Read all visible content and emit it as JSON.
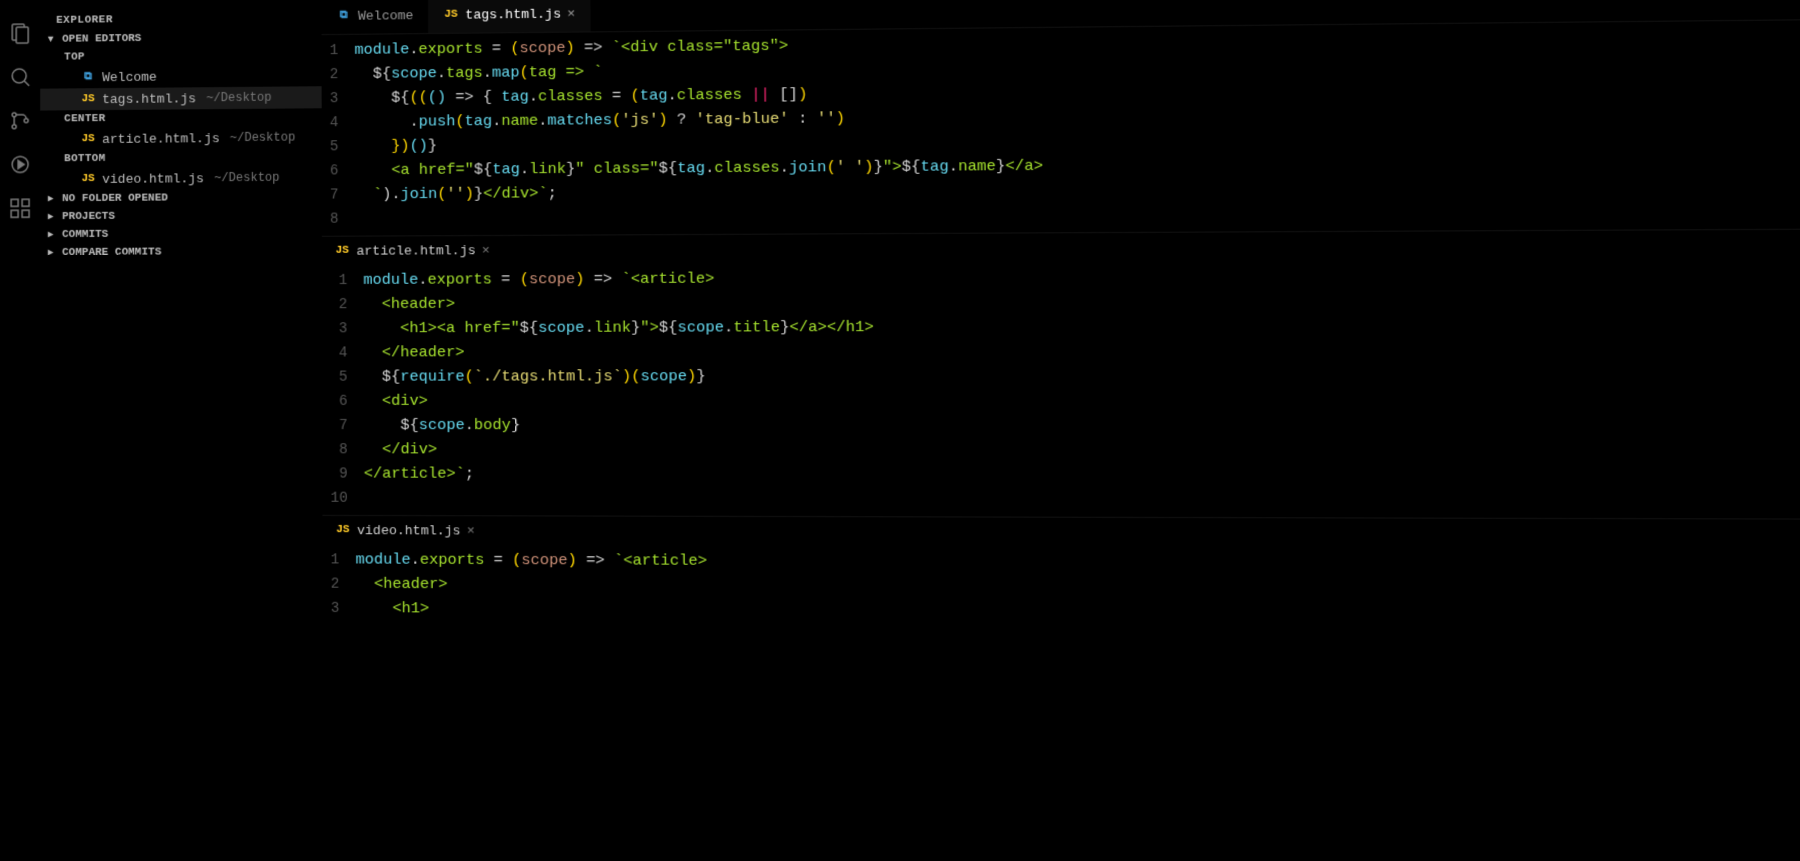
{
  "sidebar": {
    "title": "EXPLORER",
    "open_editors_label": "OPEN EDITORS",
    "groups": {
      "top": {
        "label": "TOP",
        "items": [
          {
            "icon": "vscode",
            "name": "Welcome",
            "path": ""
          },
          {
            "icon": "js",
            "name": "tags.html.js",
            "path": "~/Desktop"
          }
        ]
      },
      "center": {
        "label": "CENTER",
        "items": [
          {
            "icon": "js",
            "name": "article.html.js",
            "path": "~/Desktop"
          }
        ]
      },
      "bottom": {
        "label": "BOTTOM",
        "items": [
          {
            "icon": "js",
            "name": "video.html.js",
            "path": "~/Desktop"
          }
        ]
      }
    },
    "sections": [
      "NO FOLDER OPENED",
      "PROJECTS",
      "COMMITS",
      "COMPARE COMMITS"
    ]
  },
  "tabs": {
    "top": [
      {
        "icon": "vscode",
        "label": "Welcome",
        "active": false,
        "closable": false
      },
      {
        "icon": "js",
        "label": "tags.html.js",
        "active": true,
        "closable": true
      }
    ]
  },
  "panes": {
    "top": {
      "file": "tags.html.js",
      "lines": [
        "1",
        "2",
        "3",
        "4",
        "5",
        "6",
        "7",
        "8"
      ],
      "tokens": [
        [
          [
            "module",
            "t-skyblue"
          ],
          [
            ".",
            "t-white"
          ],
          [
            "exports",
            "t-lime"
          ],
          [
            " = ",
            "t-white"
          ],
          [
            "(",
            "t-gold"
          ],
          [
            "scope",
            "t-orange"
          ],
          [
            ")",
            "t-gold"
          ],
          [
            " => ",
            "t-white"
          ],
          [
            "`<div class=\"tags\">",
            "t-lime"
          ]
        ],
        [
          [
            "  ${",
            "t-white"
          ],
          [
            "scope",
            "t-skyblue"
          ],
          [
            ".",
            "t-white"
          ],
          [
            "tags",
            "t-lime"
          ],
          [
            ".",
            "t-white"
          ],
          [
            "map",
            "t-skyblue"
          ],
          [
            "(",
            "t-gold"
          ],
          [
            "tag => `",
            "t-lime"
          ]
        ],
        [
          [
            "    ${",
            "t-white"
          ],
          [
            "((",
            "t-gold"
          ],
          [
            "()",
            "t-skyblue"
          ],
          [
            " => { ",
            "t-white"
          ],
          [
            "tag",
            "t-skyblue"
          ],
          [
            ".",
            "t-white"
          ],
          [
            "classes",
            "t-lime"
          ],
          [
            " = ",
            "t-white"
          ],
          [
            "(",
            "t-gold"
          ],
          [
            "tag",
            "t-skyblue"
          ],
          [
            ".",
            "t-white"
          ],
          [
            "classes",
            "t-lime"
          ],
          [
            " || ",
            "t-pink"
          ],
          [
            "[]",
            "t-white"
          ],
          [
            ")",
            "t-gold"
          ]
        ],
        [
          [
            "      .",
            "t-white"
          ],
          [
            "push",
            "t-skyblue"
          ],
          [
            "(",
            "t-gold"
          ],
          [
            "tag",
            "t-skyblue"
          ],
          [
            ".",
            "t-white"
          ],
          [
            "name",
            "t-lime"
          ],
          [
            ".",
            "t-white"
          ],
          [
            "matches",
            "t-skyblue"
          ],
          [
            "(",
            "t-gold"
          ],
          [
            "'js'",
            "t-string"
          ],
          [
            ")",
            "t-gold"
          ],
          [
            " ? ",
            "t-white"
          ],
          [
            "'tag-blue'",
            "t-string"
          ],
          [
            " : ",
            "t-white"
          ],
          [
            "''",
            "t-string"
          ],
          [
            ")",
            "t-gold"
          ]
        ],
        [
          [
            "    })",
            "t-gold"
          ],
          [
            "()",
            "t-skyblue"
          ],
          [
            "}",
            "t-white"
          ]
        ],
        [
          [
            "    <a href=\"",
            "t-lime"
          ],
          [
            "${",
            "t-white"
          ],
          [
            "tag",
            "t-skyblue"
          ],
          [
            ".",
            "t-white"
          ],
          [
            "link",
            "t-lime"
          ],
          [
            "}",
            "t-white"
          ],
          [
            "\" class=\"",
            "t-lime"
          ],
          [
            "${",
            "t-white"
          ],
          [
            "tag",
            "t-skyblue"
          ],
          [
            ".",
            "t-white"
          ],
          [
            "classes",
            "t-lime"
          ],
          [
            ".",
            "t-white"
          ],
          [
            "join",
            "t-skyblue"
          ],
          [
            "(",
            "t-gold"
          ],
          [
            "' '",
            "t-string"
          ],
          [
            ")",
            "t-gold"
          ],
          [
            "}",
            "t-white"
          ],
          [
            "\">",
            "t-lime"
          ],
          [
            "${",
            "t-white"
          ],
          [
            "tag",
            "t-skyblue"
          ],
          [
            ".",
            "t-white"
          ],
          [
            "name",
            "t-lime"
          ],
          [
            "}",
            "t-white"
          ],
          [
            "</a>",
            "t-lime"
          ]
        ],
        [
          [
            "  `",
            "t-lime"
          ],
          [
            ").",
            "t-white"
          ],
          [
            "join",
            "t-skyblue"
          ],
          [
            "(",
            "t-gold"
          ],
          [
            "''",
            "t-string"
          ],
          [
            ")",
            "t-gold"
          ],
          [
            "}",
            "t-white"
          ],
          [
            "</div>`",
            "t-lime"
          ],
          [
            ";",
            "t-white"
          ]
        ],
        [
          [
            "",
            "t-white"
          ]
        ]
      ]
    },
    "center": {
      "file": "article.html.js",
      "lines": [
        "1",
        "2",
        "3",
        "4",
        "5",
        "6",
        "7",
        "8",
        "9",
        "10"
      ],
      "tokens": [
        [
          [
            "module",
            "t-skyblue"
          ],
          [
            ".",
            "t-white"
          ],
          [
            "exports",
            "t-lime"
          ],
          [
            " = ",
            "t-white"
          ],
          [
            "(",
            "t-gold"
          ],
          [
            "scope",
            "t-orange"
          ],
          [
            ")",
            "t-gold"
          ],
          [
            " => ",
            "t-white"
          ],
          [
            "`<article>",
            "t-lime"
          ]
        ],
        [
          [
            "  <header>",
            "t-lime"
          ]
        ],
        [
          [
            "    <h1><a href=\"",
            "t-lime"
          ],
          [
            "${",
            "t-white"
          ],
          [
            "scope",
            "t-skyblue"
          ],
          [
            ".",
            "t-white"
          ],
          [
            "link",
            "t-lime"
          ],
          [
            "}",
            "t-white"
          ],
          [
            "\">",
            "t-lime"
          ],
          [
            "${",
            "t-white"
          ],
          [
            "scope",
            "t-skyblue"
          ],
          [
            ".",
            "t-white"
          ],
          [
            "title",
            "t-lime"
          ],
          [
            "}",
            "t-white"
          ],
          [
            "</a></h1>",
            "t-lime"
          ]
        ],
        [
          [
            "  </header>",
            "t-lime"
          ]
        ],
        [
          [
            "  ${",
            "t-white"
          ],
          [
            "require",
            "t-skyblue"
          ],
          [
            "(",
            "t-gold"
          ],
          [
            "`./tags.html.js`",
            "t-string"
          ],
          [
            ")",
            "t-gold"
          ],
          [
            "(",
            "t-gold"
          ],
          [
            "scope",
            "t-skyblue"
          ],
          [
            ")",
            "t-gold"
          ],
          [
            "}",
            "t-white"
          ]
        ],
        [
          [
            "  <div>",
            "t-lime"
          ]
        ],
        [
          [
            "    ${",
            "t-white"
          ],
          [
            "scope",
            "t-skyblue"
          ],
          [
            ".",
            "t-white"
          ],
          [
            "body",
            "t-lime"
          ],
          [
            "}",
            "t-white"
          ]
        ],
        [
          [
            "  </div>",
            "t-lime"
          ]
        ],
        [
          [
            "</article>`",
            "t-lime"
          ],
          [
            ";",
            "t-white"
          ]
        ],
        [
          [
            "",
            "t-white"
          ]
        ]
      ]
    },
    "bottom": {
      "file": "video.html.js",
      "lines": [
        "1",
        "2",
        "3"
      ],
      "tokens": [
        [
          [
            "module",
            "t-skyblue"
          ],
          [
            ".",
            "t-white"
          ],
          [
            "exports",
            "t-lime"
          ],
          [
            " = ",
            "t-white"
          ],
          [
            "(",
            "t-gold"
          ],
          [
            "scope",
            "t-orange"
          ],
          [
            ")",
            "t-gold"
          ],
          [
            " => ",
            "t-white"
          ],
          [
            "`<article>",
            "t-lime"
          ]
        ],
        [
          [
            "  <header>",
            "t-lime"
          ]
        ],
        [
          [
            "    <h1>",
            "t-lime"
          ]
        ]
      ]
    }
  },
  "icons": {
    "chevron_down": "▾",
    "chevron_right": "▸",
    "close": "×",
    "js": "JS",
    "vscode": "⧉"
  }
}
